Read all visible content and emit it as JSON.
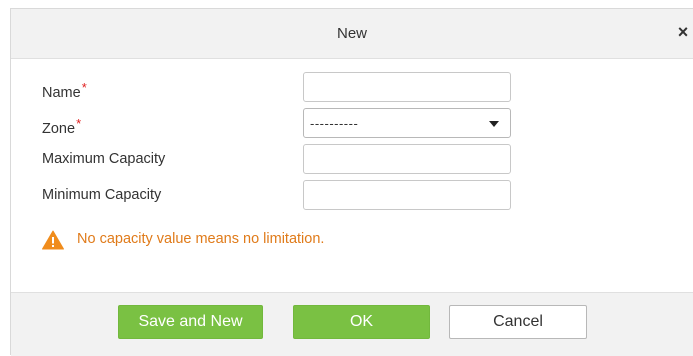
{
  "dialog": {
    "title": "New",
    "close_symbol": "×",
    "close_icon": "close-icon"
  },
  "form": {
    "name_label": "Name",
    "zone_label": "Zone",
    "required_mark": "*",
    "max_capacity_label": "Maximum Capacity",
    "min_capacity_label": "Minimum Capacity",
    "name_value": "",
    "zone_value": "----------",
    "max_capacity_value": "",
    "min_capacity_value": ""
  },
  "hint": {
    "text": "No capacity value means no limitation.",
    "icon": "warning-icon",
    "color": "#e07b1a"
  },
  "footer": {
    "save_and_new_label": "Save and New",
    "ok_label": "OK",
    "cancel_label": "Cancel"
  },
  "colors": {
    "primary_button": "#7ac143",
    "required": "#e02020",
    "warning": "#f08c1c"
  }
}
